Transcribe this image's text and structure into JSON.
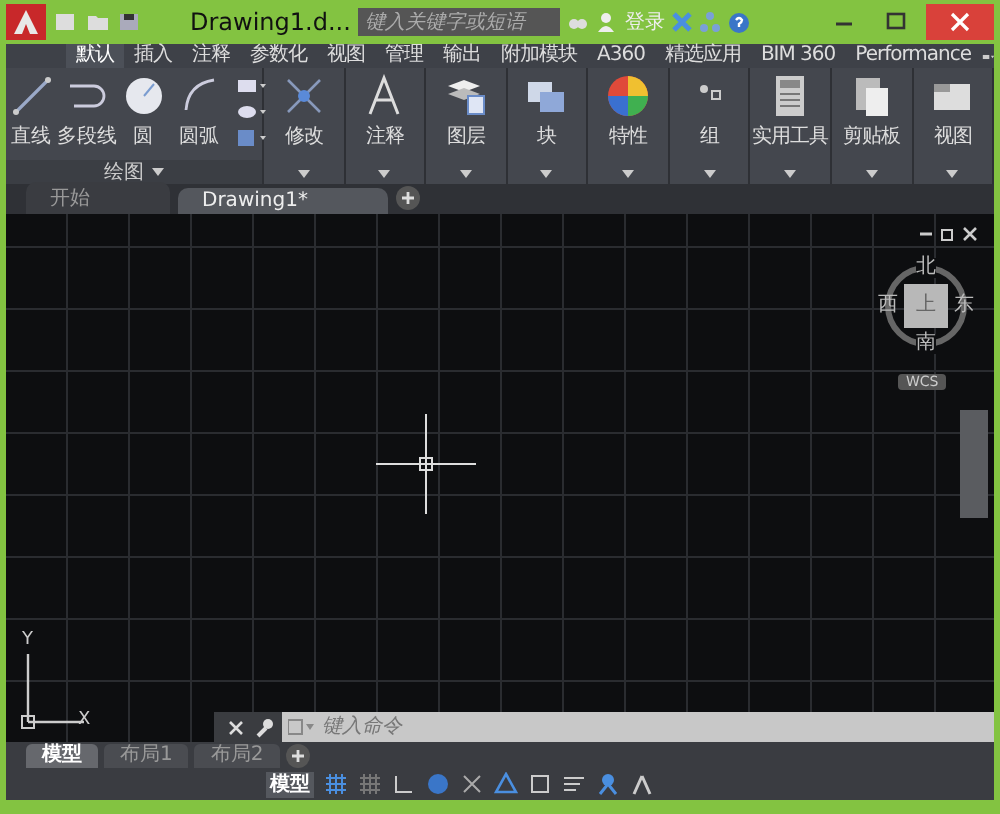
{
  "window": {
    "title": "Drawing1.d..."
  },
  "search": {
    "placeholder": "键入关键字或短语"
  },
  "user": {
    "label": "登录"
  },
  "ribbon_tabs": [
    {
      "label": "默认",
      "selected": true
    },
    {
      "label": "插入",
      "selected": false
    },
    {
      "label": "注释",
      "selected": false
    },
    {
      "label": "参数化",
      "selected": false
    },
    {
      "label": "视图",
      "selected": false
    },
    {
      "label": "管理",
      "selected": false
    },
    {
      "label": "输出",
      "selected": false
    },
    {
      "label": "附加模块",
      "selected": false
    },
    {
      "label": "A360",
      "selected": false
    },
    {
      "label": "精选应用",
      "selected": false
    },
    {
      "label": "BIM 360",
      "selected": false
    },
    {
      "label": "Performance",
      "selected": false
    }
  ],
  "draw_panel": {
    "title": "绘图",
    "tools": [
      {
        "label": "直线",
        "kind": "line"
      },
      {
        "label": "多段线",
        "kind": "polyline"
      },
      {
        "label": "圆",
        "kind": "circle"
      },
      {
        "label": "圆弧",
        "kind": "arc"
      }
    ]
  },
  "panels": [
    {
      "label": "修改",
      "kind": "modify"
    },
    {
      "label": "注释",
      "kind": "text"
    },
    {
      "label": "图层",
      "kind": "layers"
    },
    {
      "label": "块",
      "kind": "block"
    },
    {
      "label": "特性",
      "kind": "properties"
    },
    {
      "label": "组",
      "kind": "group"
    },
    {
      "label": "实用工具",
      "kind": "calculator"
    },
    {
      "label": "剪贴板",
      "kind": "clipboard"
    },
    {
      "label": "视图",
      "kind": "view"
    }
  ],
  "file_tabs": [
    {
      "label": "开始",
      "selected": false
    },
    {
      "label": "Drawing1*",
      "selected": true
    }
  ],
  "viewcube": {
    "top": "上",
    "north": "北",
    "south": "南",
    "east": "东",
    "west": "西",
    "wcs": "WCS"
  },
  "ucs": {
    "x": "X",
    "y": "Y"
  },
  "command_line": {
    "placeholder": "键入命令"
  },
  "layout_tabs": [
    {
      "label": "模型",
      "selected": true
    },
    {
      "label": "布局1",
      "selected": false
    },
    {
      "label": "布局2",
      "selected": false
    }
  ],
  "status_bar": {
    "model": "模型"
  }
}
